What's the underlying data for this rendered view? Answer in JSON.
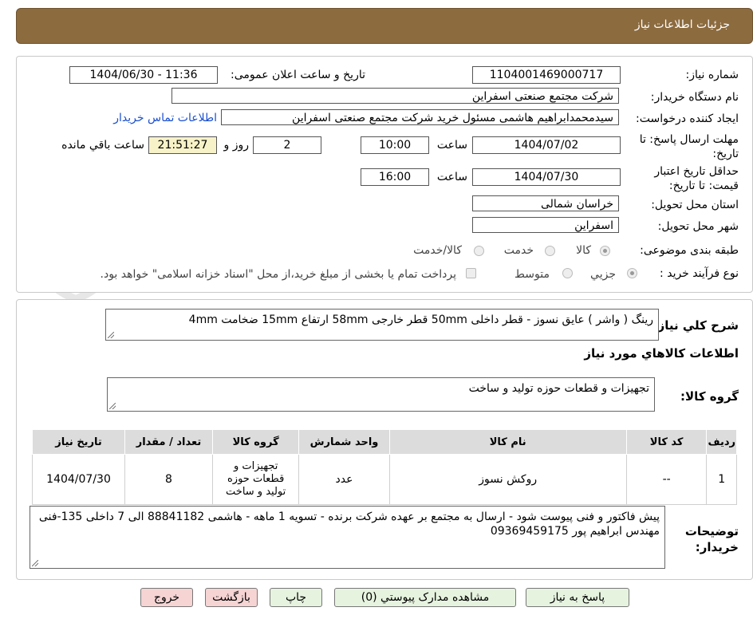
{
  "header": {
    "title": "جزئیات اطلاعات نیاز"
  },
  "form": {
    "need_number_label": "شماره نیاز:",
    "need_number": "1104001469000717",
    "announce_label": "تاریخ و ساعت اعلان عمومی:",
    "announce_value": "1404/06/30 - 11:36",
    "buyer_org_label": "نام دستگاه خریدار:",
    "buyer_org": "شرکت مجتمع صنعتی اسفراین",
    "requester_label": "ایجاد کننده درخواست:",
    "requester": "سیدمحمدابراهیم هاشمی مسئول خرید شرکت مجتمع صنعتی اسفراین",
    "contact_link": "اطلاعات تماس خریدار",
    "deadline_label": "مهلت ارسال پاسخ: تا تاریخ:",
    "deadline_date": "1404/07/02",
    "time_label": "ساعت",
    "deadline_time": "10:00",
    "days_value": "2",
    "days_label": "روز و",
    "remaining_time": "21:51:27",
    "remaining_label": "ساعت باقي مانده",
    "validity_label": "حداقل تاریخ اعتبار قیمت: تا تاریخ:",
    "validity_date": "1404/07/30",
    "validity_time": "16:00",
    "province_label": "استان محل تحویل:",
    "province": "خراسان شمالی",
    "city_label": "شهر محل تحویل:",
    "city": "اسفراین",
    "category_label": "طبقه بندی موضوعی:",
    "category_options": [
      "کالا",
      "خدمت",
      "کالا/خدمت"
    ],
    "process_label": "نوع فرآیند خرید :",
    "process_options": [
      "جزیي",
      "متوسط"
    ],
    "process_note": "پرداخت تمام یا بخشی از مبلغ خرید،از محل \"اسناد خزانه اسلامی\" خواهد بود."
  },
  "summary": {
    "label": "شرح کلي نياز:",
    "text": "رینگ ( واشر ) عایق نسوز - قطر داخلی 50mm قطر خارجی 58mm ارتفاع 15mm ضخامت 4mm",
    "goods_info_title": "اطلاعات کالاهاي مورد نياز",
    "goods_group_label": "گروه کالا:",
    "goods_group": "تجهیزات و قطعات حوزه تولید و ساخت"
  },
  "table": {
    "headers": [
      "ردیف",
      "کد کالا",
      "نام کالا",
      "واحد شمارش",
      "گروه کالا",
      "تعداد / مقدار",
      "تاریخ نیاز"
    ],
    "rows": [
      [
        "1",
        "--",
        "روکش نسوز",
        "عدد",
        "تجهیزات و قطعات حوزه تولید و ساخت",
        "8",
        "1404/07/30"
      ]
    ]
  },
  "buyer_notes": {
    "label": "توضیحات خریدار:",
    "text": "پیش فاکتور و فنی پیوست شود - ارسال به مجتمع بر عهده شرکت برنده - تسویه 1 ماهه - هاشمی 88841182 الی 7 داخلی 135-فنی مهندس ابراهیم پور 09369459175"
  },
  "buttons": {
    "reply": "پاسخ به نیاز",
    "attachments": "مشاهده مدارک پیوستي (0)",
    "print": "چاپ",
    "back": "بازگشت",
    "exit": "خروج"
  },
  "watermark": {
    "text": "AriaTender.neT"
  },
  "colors": {
    "title_bar": "#8c6b3f",
    "remaining_bg": "#f7f2c8",
    "link": "#1a4fd0",
    "button_green": "#e6f3df",
    "button_pink": "#f6d4d4"
  }
}
